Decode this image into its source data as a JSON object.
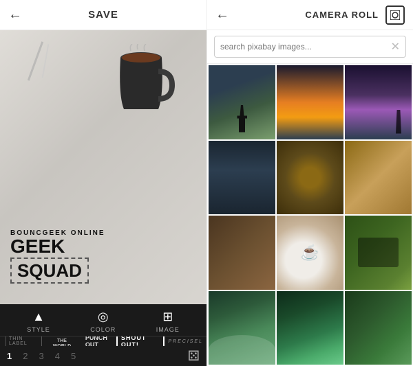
{
  "left": {
    "header": {
      "save_label": "SAVE",
      "back_arrow": "←"
    },
    "canvas": {
      "text_line1": "BOUNCGEEK ONLINE",
      "text_line2": "GEEK",
      "text_line3": "SQUAD"
    },
    "toolbar": {
      "style_label": "STYLE",
      "color_label": "COLOR",
      "image_label": "IMAGE",
      "styles": [
        {
          "id": "thin",
          "label": "THIN LABEL"
        },
        {
          "id": "around",
          "label": "AROUND THE WORLD"
        },
        {
          "id": "punch",
          "label": "PUNCH OUT"
        },
        {
          "id": "shout",
          "label": "SHOUT OUT!"
        },
        {
          "id": "precise",
          "label": "PRECISEL"
        }
      ],
      "pages": [
        "1",
        "2",
        "3",
        "4",
        "5"
      ]
    }
  },
  "right": {
    "header": {
      "back_arrow": "←",
      "camera_roll_label": "CAMERA ROLL"
    },
    "search": {
      "placeholder": "search pixabay images..."
    },
    "images": [
      {
        "id": 1,
        "alt": "forest silhouette"
      },
      {
        "id": 2,
        "alt": "galaxy orange"
      },
      {
        "id": 3,
        "alt": "galaxy purple"
      },
      {
        "id": 4,
        "alt": "night sky"
      },
      {
        "id": 5,
        "alt": "wood logs"
      },
      {
        "id": 6,
        "alt": "wood planks"
      },
      {
        "id": 7,
        "alt": "dark wood"
      },
      {
        "id": 8,
        "alt": "coffee mug"
      },
      {
        "id": 9,
        "alt": "typewriter"
      },
      {
        "id": 10,
        "alt": "ocean waves"
      },
      {
        "id": 11,
        "alt": "green plants"
      },
      {
        "id": 12,
        "alt": "clover leaves"
      }
    ]
  }
}
